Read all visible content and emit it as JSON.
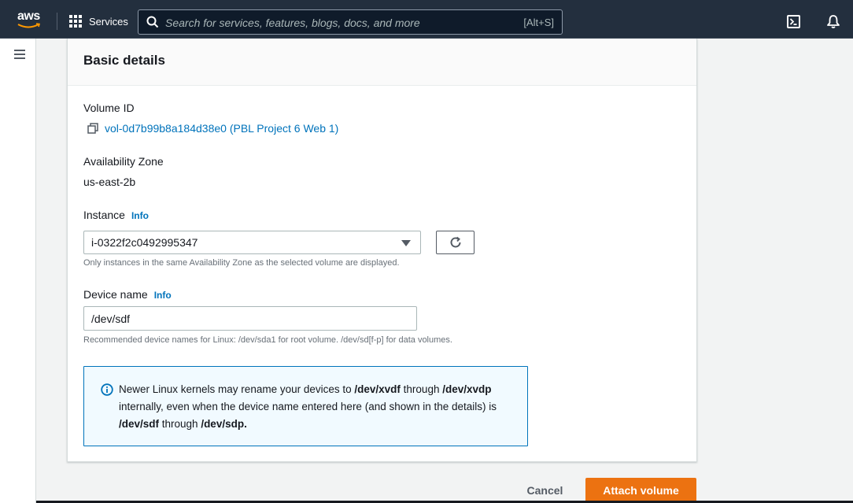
{
  "nav": {
    "logo_text": "aws",
    "services_label": "Services",
    "search_placeholder": "Search for services, features, blogs, docs, and more",
    "search_shortcut": "[Alt+S]"
  },
  "panel": {
    "title": "Basic details",
    "volume_id_label": "Volume ID",
    "volume_id_value": "vol-0d7b99b8a184d38e0 (PBL Project 6 Web 1)",
    "az_label": "Availability Zone",
    "az_value": "us-east-2b",
    "instance_label": "Instance",
    "instance_info": "Info",
    "instance_value": "i-0322f2c0492995347",
    "instance_hint": "Only instances in the same Availability Zone as the selected volume are displayed.",
    "device_label": "Device name",
    "device_info": "Info",
    "device_value": "/dev/sdf",
    "device_hint": "Recommended device names for Linux: /dev/sda1 for root volume. /dev/sd[f-p] for data volumes.",
    "alert": {
      "t1": "Newer Linux kernels may rename your devices to ",
      "b1": "/dev/xvdf",
      "t2": " through ",
      "b2": "/dev/xvdp",
      "t3": " internally, even when the device name entered here (and shown in the details) is ",
      "b3": "/dev/sdf",
      "t4": " through ",
      "b4": "/dev/sdp."
    }
  },
  "footer": {
    "cancel_label": "Cancel",
    "attach_label": "Attach volume"
  },
  "colors": {
    "nav_bg": "#232f3e",
    "link": "#0073bb",
    "primary_button": "#ec7211",
    "alert_bg": "#f1faff"
  }
}
